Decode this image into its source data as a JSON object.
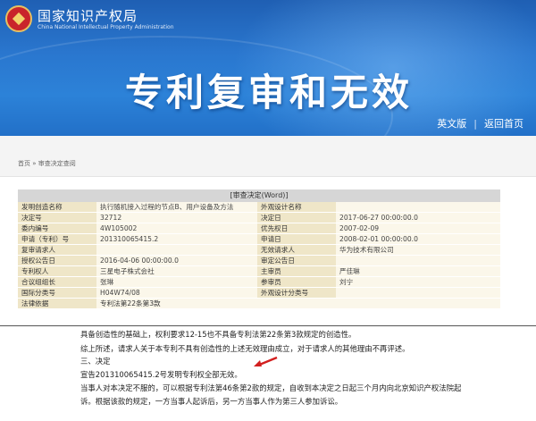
{
  "header": {
    "logo_cn": "国家知识产权局",
    "logo_en": "China National Intellectual Property Administration",
    "title": "专利复审和无效",
    "nav": [
      {
        "label": "英文版"
      },
      {
        "label": "返回首页"
      }
    ]
  },
  "breadcrumb": "首页 » 审查决定查阅",
  "table": {
    "header": "[审查决定(Word)]",
    "rows": [
      {
        "l1": "发明创造名称",
        "v1": "执行随机接入过程的节点B、用户设备及方法",
        "l2": "外观设计名称",
        "v2": ""
      },
      {
        "l1": "决定号",
        "v1": "32712",
        "l2": "决定日",
        "v2": "2017-06-27 00:00:00.0"
      },
      {
        "l1": "委内编号",
        "v1": "4W105002",
        "l2": "优先权日",
        "v2": "2007-02-09"
      },
      {
        "l1": "申请（专利）号",
        "v1": "201310065415.2",
        "l2": "申请日",
        "v2": "2008-02-01 00:00:00.0"
      },
      {
        "l1": "复审请求人",
        "v1": "",
        "l2": "无效请求人",
        "v2": "华为技术有限公司"
      },
      {
        "l1": "授权公告日",
        "v1": "2016-04-06 00:00:00.0",
        "l2": "审定公告日",
        "v2": ""
      },
      {
        "l1": "专利权人",
        "v1": "三星电子株式会社",
        "l2": "主审员",
        "v2": "严佳琳"
      },
      {
        "l1": "合议组组长",
        "v1": "张琳",
        "l2": "参审员",
        "v2": "刘宁"
      },
      {
        "l1": "国际分类号",
        "v1": "H04W74/08",
        "l2": "外观设计分类号",
        "v2": ""
      },
      {
        "l1": "法律依据",
        "v1": "专利法第22条第3款",
        "l2": "",
        "v2": ""
      }
    ]
  },
  "doc": {
    "lines": [
      "具备创造性的基础上，权利要求12-15也不具备专利法第22条第3款规定的创造性。",
      "综上所述，请求人关于本专利不具有创造性的上述无效理由成立，对于请求人的其他理由不再评述。",
      "三、决定",
      "宣告201310065415.2号发明专利权全部无效。",
      "当事人对本决定不服的，可以根据专利法第46条第2款的规定，自收到本决定之日起三个月内向北京知识产权法院起",
      "诉。根据该款的规定，一方当事人起诉后，另一方当事人作为第三人参加诉讼。"
    ]
  },
  "colors": {
    "banner": "#2a77cf",
    "label_bg": "#efe6c8",
    "value_bg": "#fbf7ea",
    "arrow": "#d21f1f"
  }
}
